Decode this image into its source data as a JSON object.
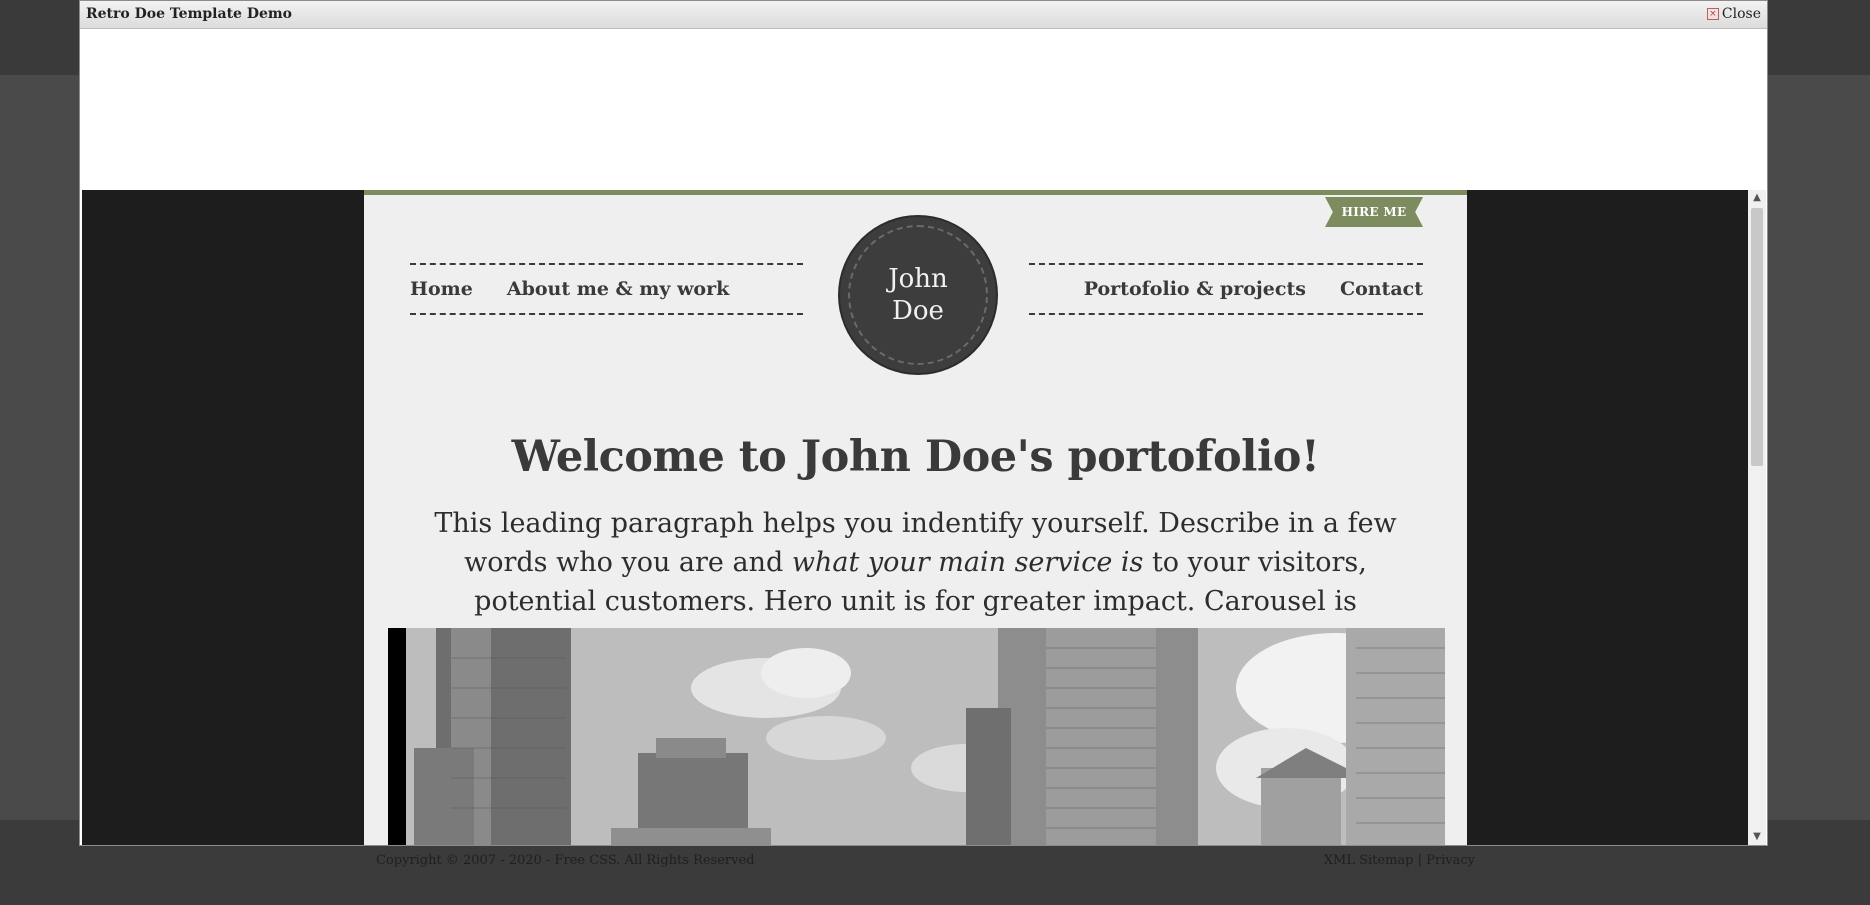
{
  "background_footer": {
    "copyright": "Copyright © 2007 - 2020 - Free CSS. All Rights Reserved",
    "sitemap": "XML Sitemap",
    "separator": "|",
    "privacy": "Privacy"
  },
  "modal": {
    "title": "Retro Doe Template Demo",
    "close_label": "Close"
  },
  "site": {
    "hire_me": "HIRE ME",
    "nav_left": [
      "Home",
      "About me & my work"
    ],
    "nav_right": [
      "Portofolio & projects",
      "Contact"
    ],
    "logo_line1": "John",
    "logo_line2": "Doe",
    "hero_title": "Welcome to John Doe's portofolio!",
    "hero_lead_1": "This leading paragraph helps you indentify yourself. Describe in a few words who you are and ",
    "hero_lead_em": "what your main service is",
    "hero_lead_2": " to your visitors, potential customers. Hero unit is for greater impact. Carousel is optional."
  },
  "colors": {
    "accent": "#7d8c5f",
    "text": "#3a3a3a",
    "logo_bg": "#3d3d3d",
    "outer_bg": "#1d1d1d"
  }
}
